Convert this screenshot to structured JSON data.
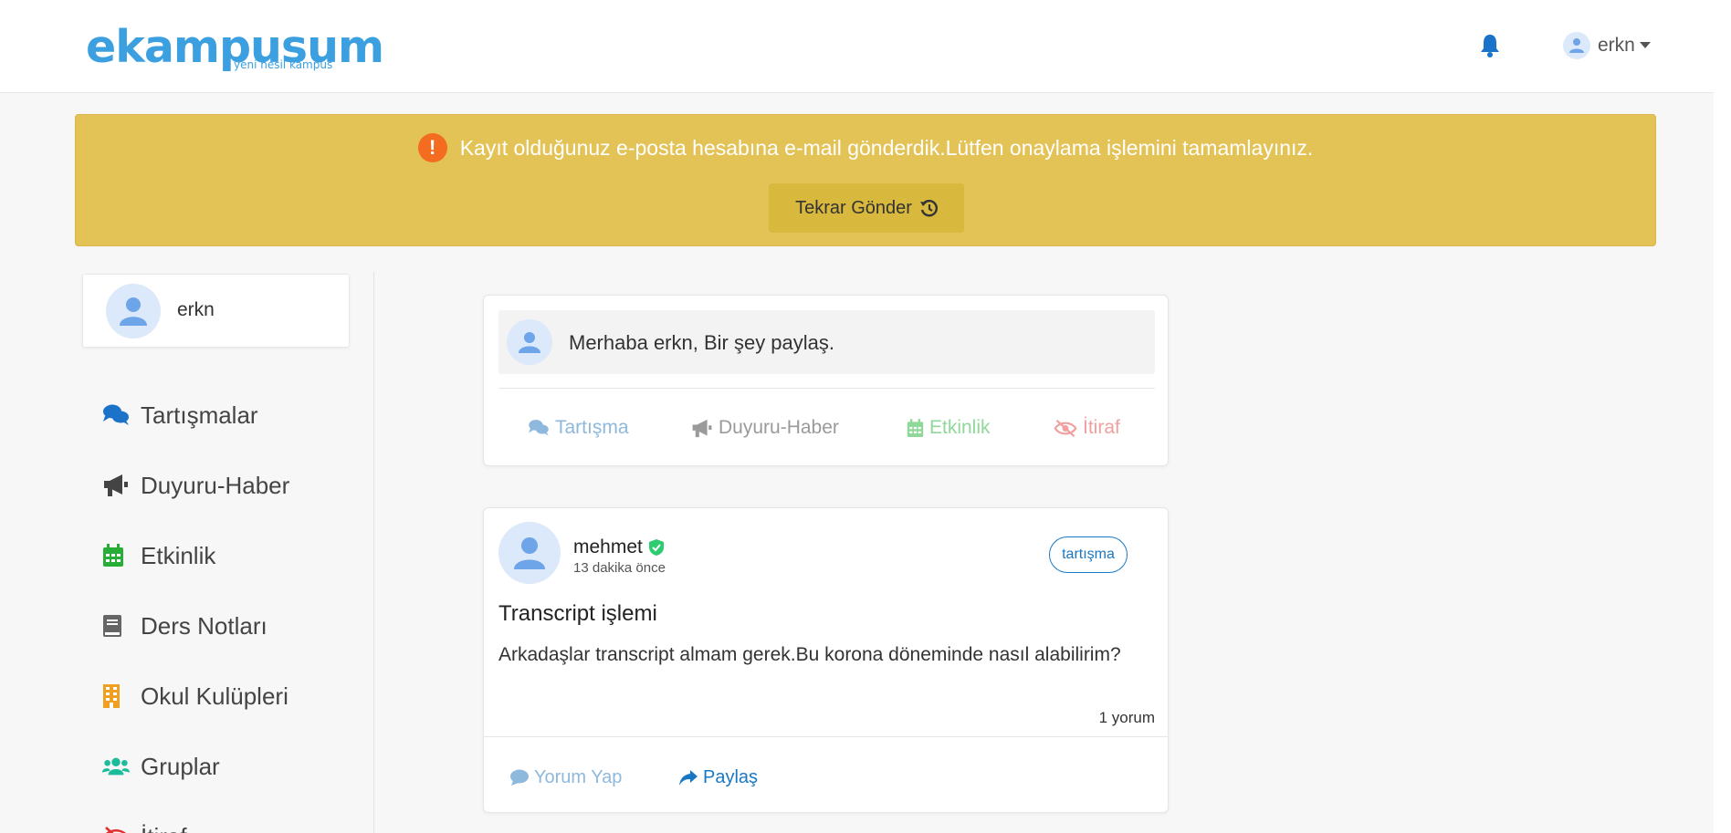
{
  "header": {
    "logo_main": "ekampusum",
    "logo_sub": "yeni nesil kampüs",
    "username": "erkn"
  },
  "alert": {
    "message": "Kayıt olduğunuz e-posta hesabına e-mail gönderdik.Lütfen onaylama işlemini tamamlayınız.",
    "warn_glyph": "!",
    "resend_label": "Tekrar Gönder"
  },
  "sidebar": {
    "profile_name": "erkn",
    "items": [
      {
        "label": "Tartışmalar",
        "icon": "comments-icon",
        "color": "#1a73c9"
      },
      {
        "label": "Duyuru-Haber",
        "icon": "megaphone-icon",
        "color": "#444444"
      },
      {
        "label": "Etkinlik",
        "icon": "calendar-icon",
        "color": "#27ae37"
      },
      {
        "label": "Ders Notları",
        "icon": "book-icon",
        "color": "#666666"
      },
      {
        "label": "Okul Kulüpleri",
        "icon": "building-icon",
        "color": "#f0a020"
      },
      {
        "label": "Gruplar",
        "icon": "users-icon",
        "color": "#1abc9c"
      },
      {
        "label": "İtiraf",
        "icon": "eye-slash-icon",
        "color": "#e03030"
      }
    ]
  },
  "composer": {
    "placeholder": "Merhaba erkn, Bir şey paylaş.",
    "types": [
      {
        "label": "Tartışma",
        "color": "#8fb8dd"
      },
      {
        "label": "Duyuru-Haber",
        "color": "#9a9a9a"
      },
      {
        "label": "Etkinlik",
        "color": "#8fd89a"
      },
      {
        "label": "İtiraf",
        "color": "#f0a0a0"
      }
    ]
  },
  "post": {
    "author": "mehmet",
    "time": "13 dakika önce",
    "tag": "tartışma",
    "title": "Transcript işlemi",
    "body": "Arkadaşlar transcript almam gerek.Bu korona döneminde nasıl alabilirim?",
    "comment_count": "1 yorum",
    "comment_label": "Yorum Yap",
    "share_label": "Paylaş"
  },
  "colors": {
    "brand": "#3b9fe0",
    "alert_bg": "#e3c256",
    "link": "#1a78c2"
  }
}
